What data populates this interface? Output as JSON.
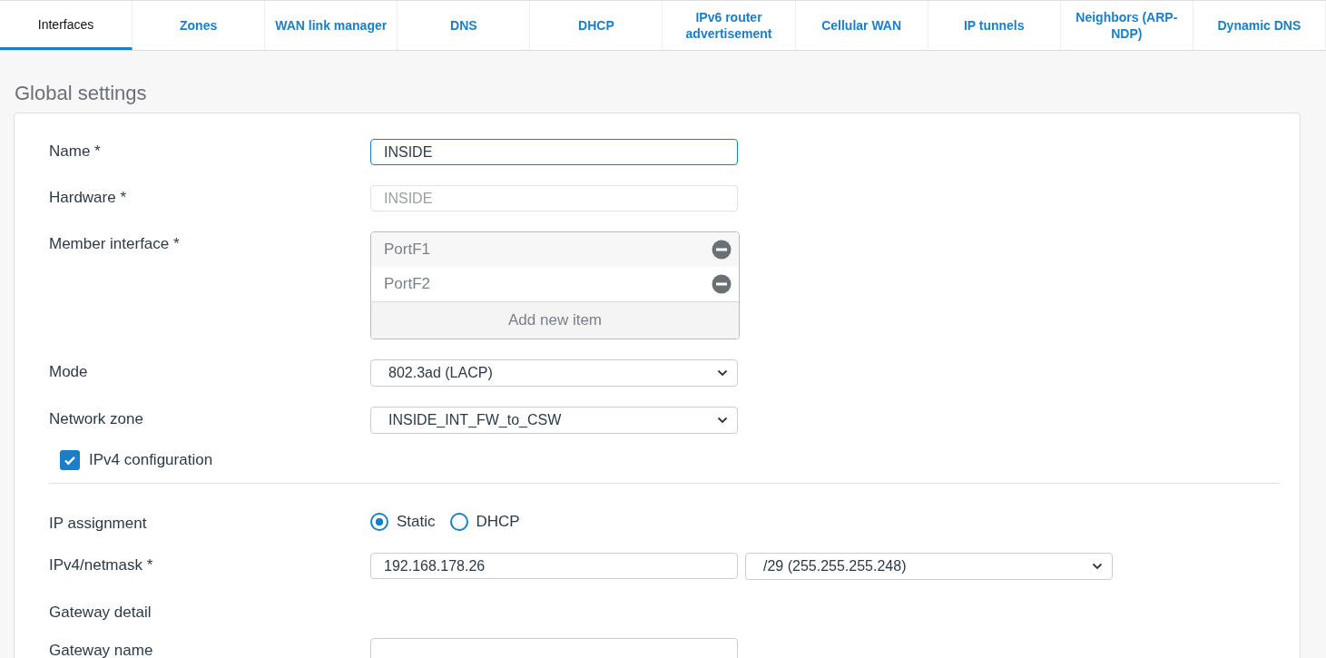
{
  "tabs": [
    {
      "label": "Interfaces",
      "selected": true
    },
    {
      "label": "Zones",
      "selected": false
    },
    {
      "label": "WAN link manager",
      "selected": false
    },
    {
      "label": "DNS",
      "selected": false
    },
    {
      "label": "DHCP",
      "selected": false
    },
    {
      "label": "IPv6 router advertisement",
      "selected": false
    },
    {
      "label": "Cellular WAN",
      "selected": false
    },
    {
      "label": "IP tunnels",
      "selected": false
    },
    {
      "label": "Neighbors (ARP-NDP)",
      "selected": false
    },
    {
      "label": "Dynamic DNS",
      "selected": false
    }
  ],
  "section_title": "Global settings",
  "fields": [
    {
      "kind": "text",
      "label": "Name *",
      "value": "INSIDE",
      "focused": true,
      "disabled": false
    },
    {
      "kind": "text",
      "label": "Hardware *",
      "value": "INSIDE",
      "focused": false,
      "disabled": true
    },
    {
      "kind": "list",
      "label": "Member interface *",
      "items": [
        "PortF1",
        "PortF2"
      ],
      "add_label": "Add new item"
    },
    {
      "kind": "select",
      "label": "Mode",
      "value": "802.3ad (LACP)"
    },
    {
      "kind": "select",
      "label": "Network zone",
      "value": "INSIDE_INT_FW_to_CSW"
    },
    {
      "kind": "checkbox",
      "label": "IPv4 configuration",
      "checked": true
    },
    {
      "kind": "radio",
      "label": "IP assignment",
      "options": [
        {
          "label": "Static",
          "selected": true
        },
        {
          "label": "DHCP",
          "selected": false
        }
      ]
    },
    {
      "kind": "ipmask",
      "label": "IPv4/netmask *",
      "value": "192.168.178.26",
      "mask": "/29 (255.255.255.248)"
    },
    {
      "kind": "heading",
      "label": "Gateway detail"
    },
    {
      "kind": "text",
      "label": "Gateway name",
      "focused": false,
      "disabled": false
    }
  ]
}
